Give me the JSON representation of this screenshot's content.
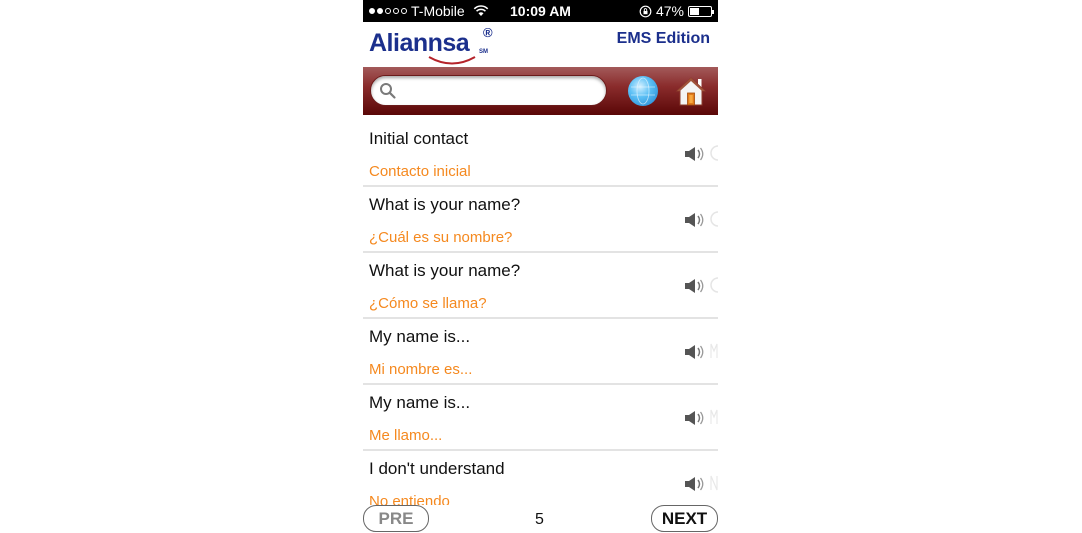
{
  "status_bar": {
    "carrier": "T-Mobile",
    "signal_bars_filled": 2,
    "signal_bars_total": 5,
    "time": "10:09 AM",
    "battery_percent_label": "47%",
    "battery_level": 0.47
  },
  "header": {
    "logo_text": "Aliannsa",
    "logo_registered": "®",
    "logo_sm": "SM",
    "edition": "EMS Edition"
  },
  "toolbar": {
    "search_placeholder": "",
    "search_value": "",
    "globe_icon": "globe-icon",
    "home_icon": "home-icon"
  },
  "phrases": [
    {
      "english": "Initial contact",
      "spanish": "Contacto inicial"
    },
    {
      "english": "What is your name?",
      "spanish": "¿Cuál es su nombre?"
    },
    {
      "english": "What is your name?",
      "spanish": "¿Cómo se llama?"
    },
    {
      "english": "My name is...",
      "spanish": "Mi nombre es..."
    },
    {
      "english": "My name is...",
      "spanish": "Me llamo..."
    },
    {
      "english": "I don't understand",
      "spanish": "No entiendo"
    }
  ],
  "pagination": {
    "prev_label": "PRE",
    "next_label": "NEXT",
    "page": "5"
  },
  "colors": {
    "brand_blue": "#1b2f8c",
    "toolbar_maroon": "#8a2c2c",
    "spanish_orange": "#f5891f"
  }
}
